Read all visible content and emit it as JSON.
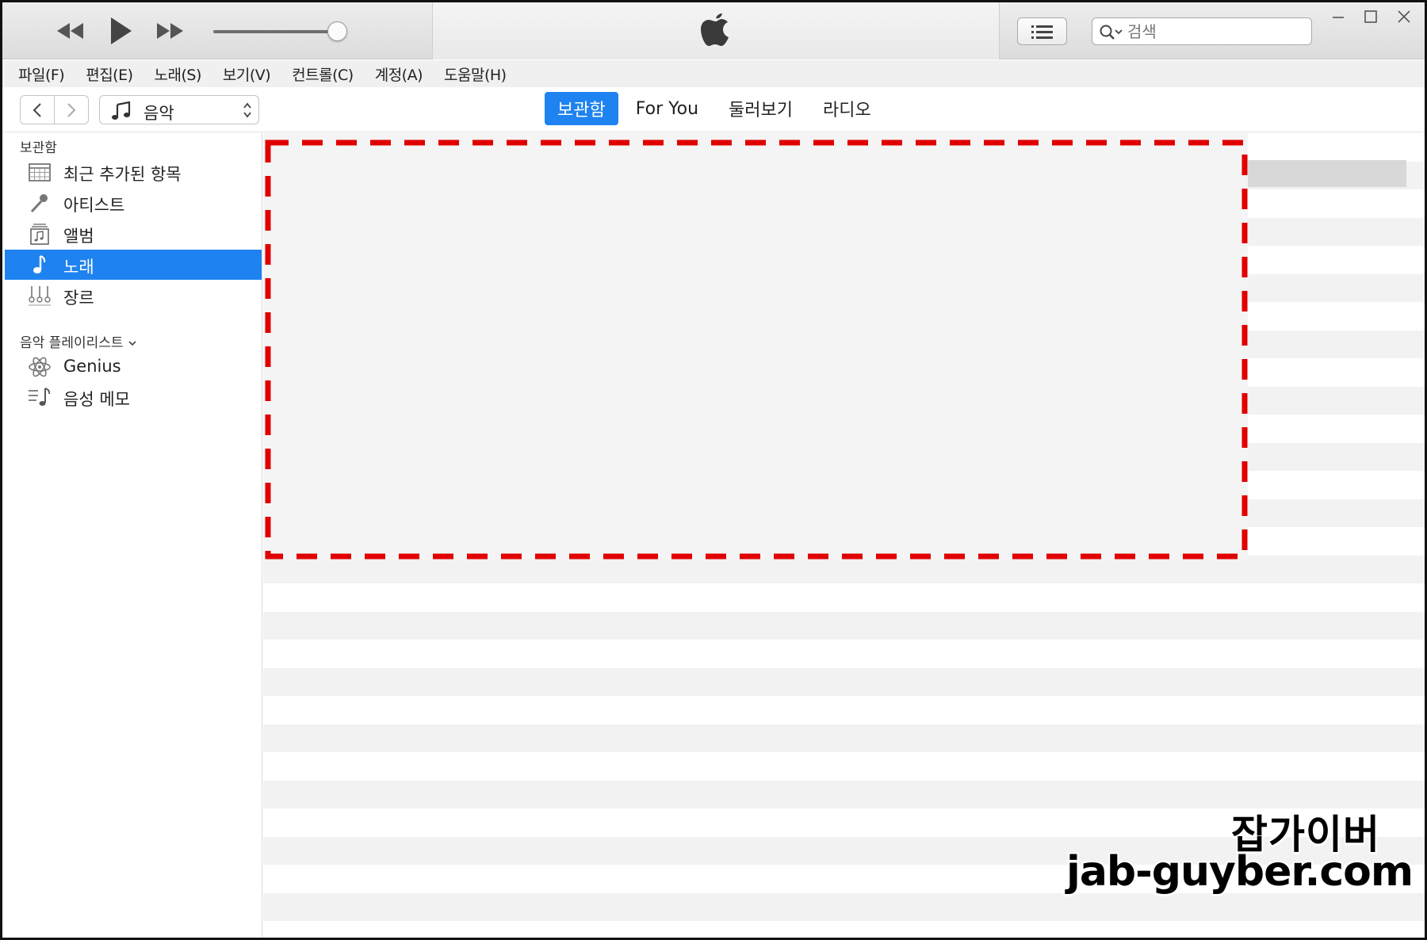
{
  "search": {
    "placeholder": "검색"
  },
  "menu": [
    "파일(F)",
    "편집(E)",
    "노래(S)",
    "보기(V)",
    "컨트롤(C)",
    "계정(A)",
    "도움말(H)"
  ],
  "media_picker": {
    "selected": "음악"
  },
  "tabs": [
    {
      "label": "보관함",
      "active": true
    },
    {
      "label": "For You",
      "active": false
    },
    {
      "label": "둘러보기",
      "active": false
    },
    {
      "label": "라디오",
      "active": false
    }
  ],
  "sidebar": {
    "library_header": "보관함",
    "library_items": [
      {
        "label": "최근 추가된 항목",
        "icon": "calendar-icon"
      },
      {
        "label": "아티스트",
        "icon": "microphone-icon"
      },
      {
        "label": "앨범",
        "icon": "album-icon"
      },
      {
        "label": "노래",
        "icon": "music-note-icon",
        "selected": true
      },
      {
        "label": "장르",
        "icon": "genre-icon"
      }
    ],
    "playlists_header": "음악 플레이리스트",
    "playlist_items": [
      {
        "label": "Genius",
        "icon": "genius-atom-icon"
      },
      {
        "label": "음성 메모",
        "icon": "voice-memo-icon"
      }
    ]
  },
  "annotation": {
    "color": "#e00000"
  },
  "watermark": {
    "name": "잡가이버",
    "site": "jab-guyber.com"
  },
  "colors": {
    "accent": "#1e83f0"
  }
}
